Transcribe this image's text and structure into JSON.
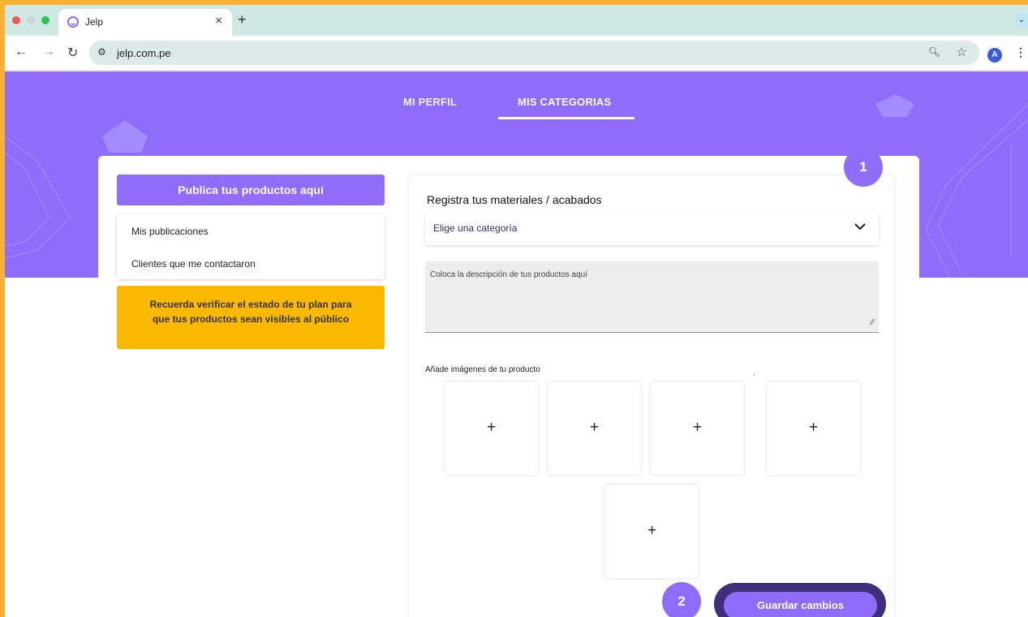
{
  "browser": {
    "tab_title": "Jelp",
    "tab_close": "×",
    "new_tab": "+",
    "url": "jelp.com.pe",
    "avatar_letter": "A",
    "colors": {
      "tabbar": "#cfe8e2",
      "omnibox": "#dcebe7",
      "frame": "#f9b233"
    }
  },
  "nav": {
    "profile": "MI PERFIL",
    "categories": "MIS CATEGORIAS",
    "active": "MIS CATEGORIAS"
  },
  "sidebar": {
    "publish_button": "Publica tus productos aquí",
    "menu": [
      {
        "label": "Mis publicaciones"
      },
      {
        "label": "Clientes que me contactaron"
      }
    ],
    "notice": "Recuerda verificar el estado de tu plan para que tus productos sean visibles al público"
  },
  "form": {
    "title": "Registra tus materiales / acabados",
    "category_select": "Elige una categoría",
    "description_placeholder": "Coloca la descripción de tus productos aquí",
    "images_label": "Añade imágenes de tu producto",
    "image_slot_symbol": "+",
    "save_button": "Guardar cambios"
  },
  "annotations": {
    "step_1": "1",
    "step_2": "2"
  },
  "theme": {
    "primary": "#8f6cfa",
    "notice": "#fbb800",
    "ring": "#3e2f7d"
  }
}
